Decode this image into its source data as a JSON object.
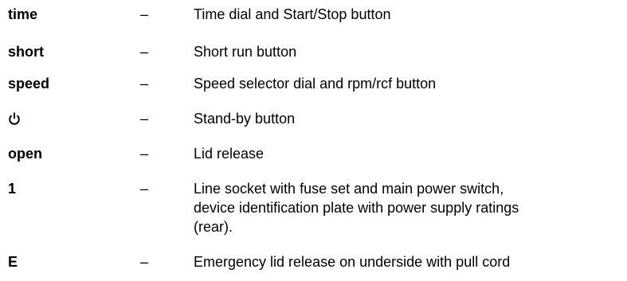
{
  "legend": {
    "items": [
      {
        "key": "time",
        "dash": "–",
        "desc": [
          "Time dial and Start/Stop button"
        ]
      },
      {
        "key": "short",
        "dash": "–",
        "desc": [
          "Short run button"
        ]
      },
      {
        "key": "speed",
        "dash": "–",
        "desc": [
          "Speed selector dial and rpm/rcf button"
        ]
      },
      {
        "key_icon": "power-icon",
        "dash": "–",
        "desc": [
          "Stand-by button"
        ]
      },
      {
        "key": "open",
        "dash": "–",
        "desc": [
          "Lid release"
        ]
      },
      {
        "key": "1",
        "dash": "–",
        "desc": [
          "Line socket with fuse set and main power switch,",
          "device identification plate with power supply ratings",
          "(rear)."
        ]
      },
      {
        "key": "E",
        "dash": "–",
        "desc": [
          "Emergency lid release on underside with pull cord"
        ]
      }
    ]
  }
}
